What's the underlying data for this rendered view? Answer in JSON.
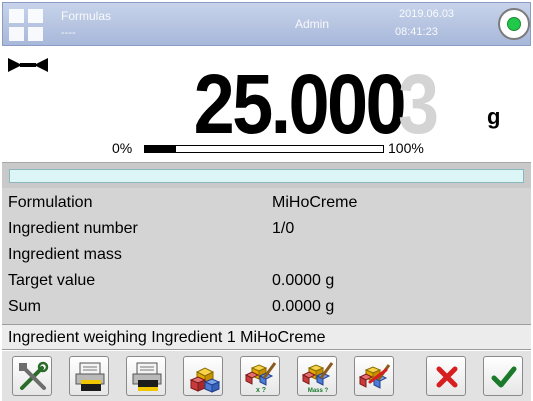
{
  "header": {
    "mode_name": "Formulas",
    "mode_sub": "----",
    "user": "Admin",
    "date": "2019.06.03",
    "time": "08:41:23",
    "status_icon": "status-ok-icon"
  },
  "display": {
    "stability_icon": "stable-marker-icon",
    "reading_main": "25.000",
    "reading_last_digit": "3",
    "unit": "g",
    "range_min_label": "0%",
    "range_max_label": "100%",
    "range_fill_fraction": 0.13
  },
  "info": {
    "rows": [
      {
        "label": "Formulation",
        "value": "MiHoCreme"
      },
      {
        "label": "Ingredient number",
        "value": "1/0"
      },
      {
        "label": "Ingredient mass",
        "value": ""
      },
      {
        "label": "Target value",
        "value": "0.0000 g"
      },
      {
        "label": "Sum",
        "value": "0.0000 g"
      }
    ]
  },
  "procedure_line": "Ingredient weighing Ingredient 1 MiHoCreme",
  "toolbar": {
    "buttons": [
      {
        "name": "settings-tools-button",
        "icon": "tools-icon"
      },
      {
        "name": "print-header-button",
        "icon": "printer-header-icon"
      },
      {
        "name": "print-footer-button",
        "icon": "printer-footer-icon"
      },
      {
        "name": "ingredient-button",
        "icon": "ingredient-blocks-icon"
      },
      {
        "name": "target-value-button",
        "icon": "target-value-icon",
        "caption": "x ?"
      },
      {
        "name": "mass-button",
        "icon": "mass-entry-icon",
        "caption": "Mass ?"
      },
      {
        "name": "skip-ingredient-button",
        "icon": "skip-ingredient-icon"
      },
      {
        "name": "cancel-button",
        "icon": "cancel-x-icon"
      },
      {
        "name": "confirm-button",
        "icon": "confirm-check-icon"
      }
    ],
    "colors": {
      "cancel": "#d81f1f",
      "confirm": "#1a7a2a"
    }
  }
}
